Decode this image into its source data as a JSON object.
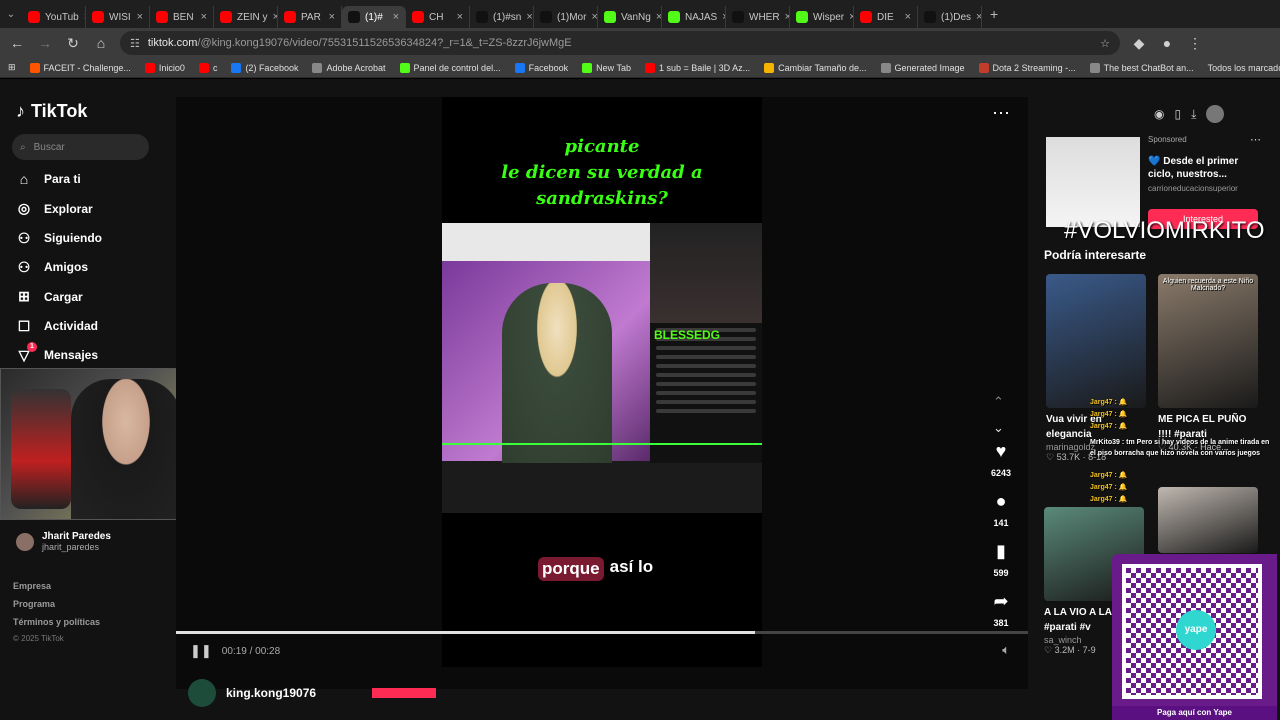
{
  "browser": {
    "tabs": [
      {
        "label": "YouTub",
        "color": "#ff0000"
      },
      {
        "label": "WISI",
        "color": "#ff0000"
      },
      {
        "label": "BEN",
        "color": "#ff0000"
      },
      {
        "label": "ZEIN y",
        "color": "#ff0000"
      },
      {
        "label": "PAR",
        "color": "#ff0000"
      },
      {
        "label": "(1)#",
        "color": "#111111"
      },
      {
        "label": "CH",
        "color": "#ff0000"
      },
      {
        "label": "(1)#sn",
        "color": "#111111"
      },
      {
        "label": "(1)Mor",
        "color": "#111111"
      },
      {
        "label": "VanNg",
        "color": "#53fc18"
      },
      {
        "label": "NAJAS",
        "color": "#53fc18"
      },
      {
        "label": "WHER",
        "color": "#111111"
      },
      {
        "label": "Wisper",
        "color": "#53fc18"
      },
      {
        "label": "DIE",
        "color": "#ff0000"
      },
      {
        "label": "(1)Des",
        "color": "#111111"
      }
    ],
    "url_host": "tiktok.com",
    "url_path": "/@king.kong19076/video/7553151152653634824?_r=1&_t=ZS-8zzrJ6jwMgE",
    "bookmarks": [
      {
        "label": "FACEIT - Challenge...",
        "color": "#ff5500"
      },
      {
        "label": "Inicio0",
        "color": "#ff0000"
      },
      {
        "label": "c",
        "color": "#ff0000"
      },
      {
        "label": "(2) Facebook",
        "color": "#1877f2"
      },
      {
        "label": "Adobe Acrobat",
        "color": "#888888"
      },
      {
        "label": "Panel de control del...",
        "color": "#53fc18"
      },
      {
        "label": "Facebook",
        "color": "#1877f2"
      },
      {
        "label": "New Tab",
        "color": "#53fc18"
      },
      {
        "label": "1 sub = Baile | 3D Az...",
        "color": "#ff0000"
      },
      {
        "label": "Cambiar Tamaño de...",
        "color": "#f4b400"
      },
      {
        "label": "Generated Image",
        "color": "#888888"
      },
      {
        "label": "Dota 2 Streaming -...",
        "color": "#c23c2a"
      },
      {
        "label": "The best ChatBot an...",
        "color": "#888888"
      }
    ],
    "all_bookmarks": "Todos los marcadores"
  },
  "sidebar": {
    "logo": "TikTok",
    "search_placeholder": "Buscar",
    "nav": [
      {
        "label": "Para ti",
        "icon": "home-icon",
        "glyph": "⌂"
      },
      {
        "label": "Explorar",
        "icon": "compass-icon",
        "glyph": "◎"
      },
      {
        "label": "Siguiendo",
        "icon": "following-icon",
        "glyph": "⚇"
      },
      {
        "label": "Amigos",
        "icon": "friends-icon",
        "glyph": "⚇"
      },
      {
        "label": "Cargar",
        "icon": "upload-icon",
        "glyph": "⊞"
      },
      {
        "label": "Actividad",
        "icon": "activity-icon",
        "glyph": "☐"
      },
      {
        "label": "Mensajes",
        "icon": "messages-icon",
        "glyph": "▽"
      }
    ],
    "messages_badge": "1",
    "followed_user": {
      "name": "Jharit Paredes",
      "handle": "jharit_paredes"
    },
    "footer": [
      "Empresa",
      "Programa",
      "Términos y políticas"
    ],
    "copyright": "© 2025 TikTok"
  },
  "video": {
    "caption_lines": [
      "picante",
      "le dicen su verdad a",
      "sandraskins?"
    ],
    "subtitle_highlight": "porque",
    "subtitle_rest": "así lo",
    "stream_brand": "BLESSEDG",
    "time": "00:19 / 00:28",
    "progress": 0.68,
    "author": "king.kong19076"
  },
  "actions": {
    "likes": "6243",
    "comments": "141",
    "saves": "599",
    "shares": "381"
  },
  "right": {
    "ad": {
      "sponsored": "Sponsored",
      "title": "💙 Desde el primer ciclo, nuestros...",
      "source": "carrioneducacionsuperior",
      "button": "Interested"
    },
    "overlay_tag": "#VOLVIOMIRKITO",
    "might_like": "Podría interesarte",
    "cards": [
      {
        "title": "Vua vivir en elegancia",
        "user": "marinagoldz",
        "meta": "♡ 53.7K · 8-18",
        "color": "#3a5a8a"
      },
      {
        "title": "ME PICA EL PUÑO !!!! #parati",
        "user": "",
        "meta": "♡ 40.3K · Hace...",
        "color": "#8a7a6a"
      },
      {
        "title": "A LA VIO A LA",
        "user": "sa_winch",
        "meta": "♡ 3.2M · 7-9",
        "color": "#5a8a7a"
      },
      {
        "title": "",
        "user": "",
        "meta": "",
        "color": "#c0b8b0"
      }
    ],
    "card2_tag": "#parati #v",
    "card_header_text": "Alguien recuerda a este Niño Malcriado?",
    "chat_lines": [
      "Jarg47 : 🔔",
      "Jarg47 : 🔔",
      "Jarg47 : 🔔"
    ],
    "chat_message": "MrKito39 : tm Pero si hay videos de la anime tirada en el piso borracha que hizo novela con varios juegos",
    "chat_tail": [
      "Jarg47 : 🔔",
      "Jarg47 : 🔔",
      "Jarg47 : 🔔"
    ],
    "qr_label": "Paga aquí con Yape",
    "qr_brand": "yape"
  }
}
